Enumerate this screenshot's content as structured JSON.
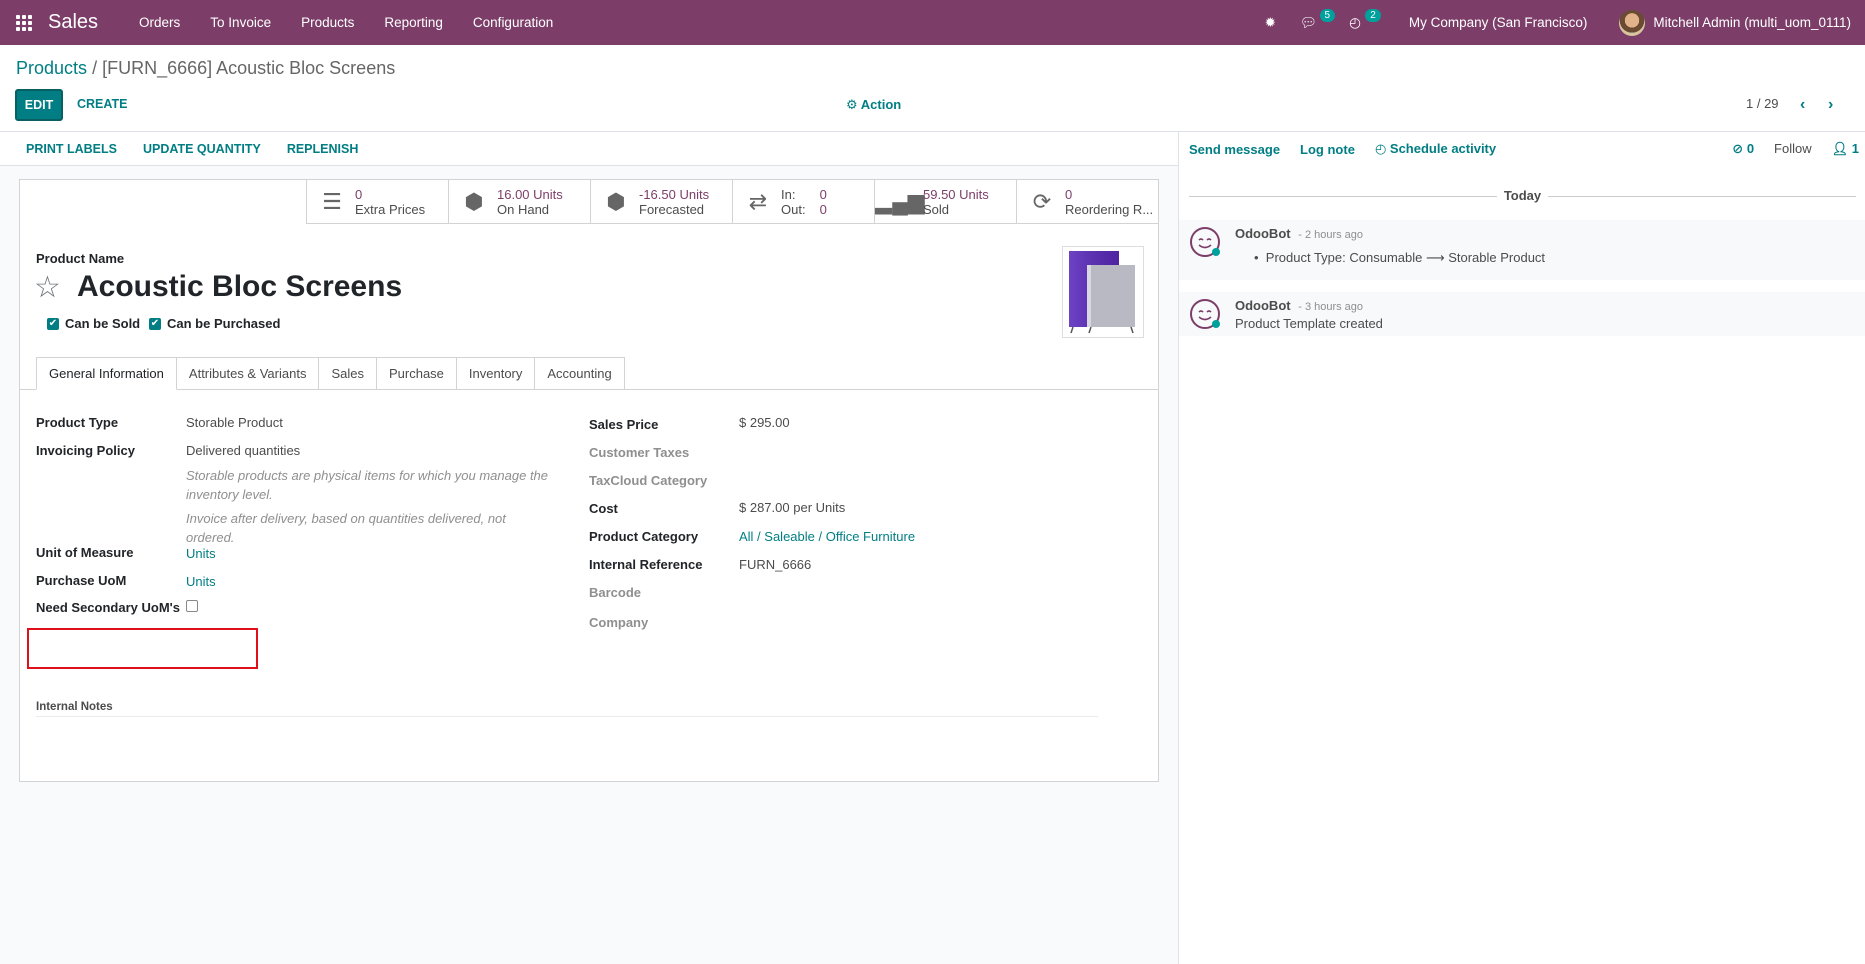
{
  "navbar": {
    "brand": "Sales",
    "menu": [
      "Orders",
      "To Invoice",
      "Products",
      "Reporting",
      "Configuration"
    ],
    "messages_count": "5",
    "activities_count": "2",
    "company": "My Company (San Francisco)",
    "user": "Mitchell Admin (multi_uom_0111)"
  },
  "breadcrumb": {
    "parent": "Products",
    "current": "[FURN_6666] Acoustic Bloc Screens"
  },
  "controls": {
    "edit": "EDIT",
    "create": "CREATE",
    "action": "Action",
    "pager": "1 / 29"
  },
  "statusbar": {
    "buttons": [
      "PRINT LABELS",
      "UPDATE QUANTITY",
      "REPLENISH"
    ]
  },
  "smart_buttons": {
    "extra_prices": {
      "value": "0",
      "label": "Extra Prices"
    },
    "on_hand": {
      "value": "16.00 Units",
      "label": "On Hand"
    },
    "forecasted": {
      "value": "-16.50 Units",
      "label": "Forecasted"
    },
    "in_out": {
      "in_label": "In:",
      "in_value": "0",
      "out_label": "Out:",
      "out_value": "0"
    },
    "sold": {
      "value": "59.50 Units",
      "label": "Sold"
    },
    "reordering": {
      "value": "0",
      "label": "Reordering R..."
    }
  },
  "product": {
    "name_label": "Product Name",
    "name": "Acoustic Bloc Screens",
    "can_be_sold": "Can be Sold",
    "can_be_purchased": "Can be Purchased"
  },
  "tabs": [
    "General Information",
    "Attributes & Variants",
    "Sales",
    "Purchase",
    "Inventory",
    "Accounting"
  ],
  "general": {
    "product_type_label": "Product Type",
    "product_type": "Storable Product",
    "invoicing_policy_label": "Invoicing Policy",
    "invoicing_policy": "Delivered quantities",
    "help_1": "Storable products are physical items for which you manage the inventory level.",
    "help_2": "Invoice after delivery, based on quantities delivered, not ordered.",
    "uom_label": "Unit of Measure",
    "uom": "Units",
    "purchase_uom_label": "Purchase UoM",
    "purchase_uom": "Units",
    "secondary_uom_label": "Need Secondary UoM's",
    "sales_price_label": "Sales Price",
    "sales_price": "$ 295.00",
    "customer_taxes_label": "Customer Taxes",
    "taxcloud_label": "TaxCloud Category",
    "cost_label": "Cost",
    "cost": "$ 287.00",
    "cost_unit": "per Units",
    "category_label": "Product Category",
    "category": "All / Saleable / Office Furniture",
    "internal_ref_label": "Internal Reference",
    "internal_ref": "FURN_6666",
    "barcode_label": "Barcode",
    "company_label": "Company",
    "internal_notes_label": "Internal Notes"
  },
  "chatter": {
    "send_message": "Send message",
    "log_note": "Log note",
    "schedule_activity": "Schedule activity",
    "attachments": "0",
    "follow": "Follow",
    "followers": "1",
    "today": "Today",
    "messages": [
      {
        "author": "OdooBot",
        "when": "- 2 hours ago",
        "body": "Product Type: Consumable ⟶ Storable Product"
      },
      {
        "author": "OdooBot",
        "when": "- 3 hours ago",
        "body": "Product Template created"
      }
    ]
  }
}
